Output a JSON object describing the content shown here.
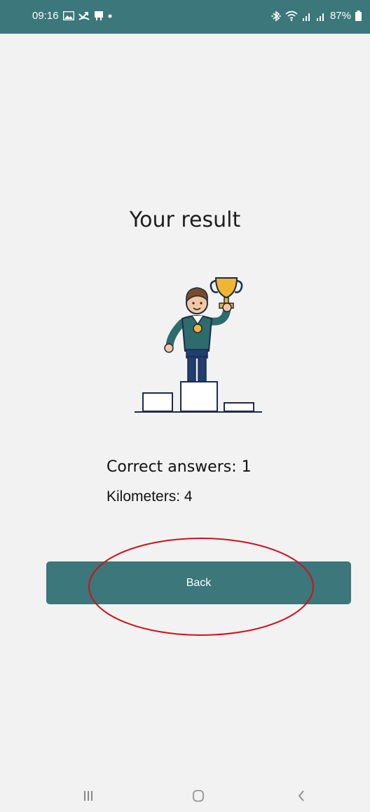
{
  "status_bar": {
    "time": "09:16",
    "battery": "87%",
    "icons_left": [
      "gallery-icon",
      "missed-call-icon",
      "message-icon",
      "notification-dot-icon"
    ],
    "icons_right": [
      "bluetooth-icon",
      "wifi-icon",
      "signal-icon",
      "signal-icon",
      "battery-icon"
    ]
  },
  "result": {
    "title": "Your result",
    "correct_answers": "Correct answers: 1",
    "kilometers": "Kilometers: 4"
  },
  "actions": {
    "back_label": "Back"
  },
  "nav_bar": {
    "icons": [
      "recent-apps-icon",
      "home-icon",
      "back-nav-icon"
    ]
  },
  "colors": {
    "accent": "#3b777b",
    "background": "#f2f2f2",
    "annotation": "#d0101a"
  }
}
